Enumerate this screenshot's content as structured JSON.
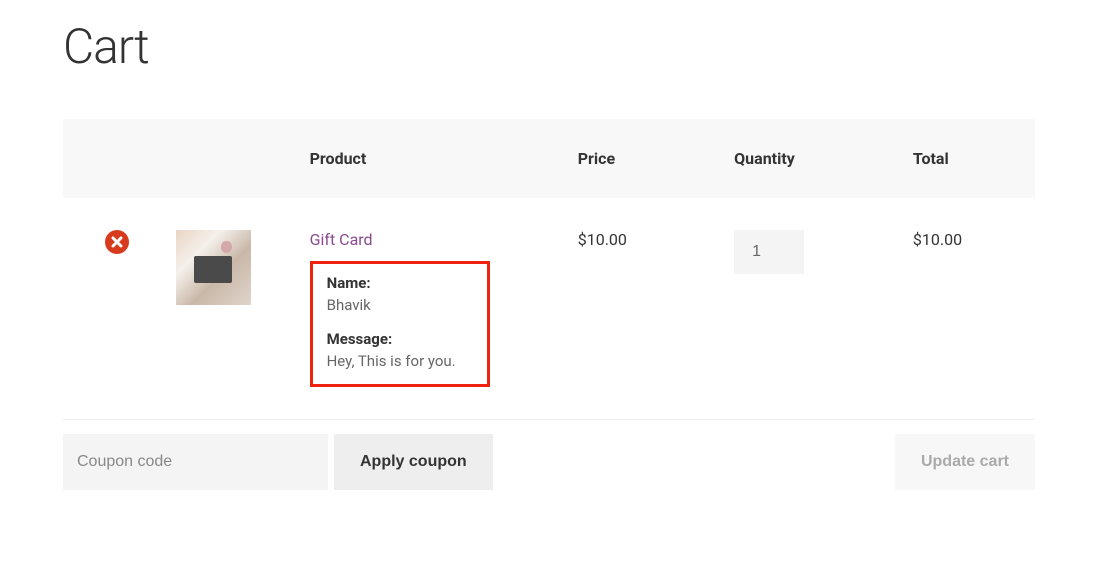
{
  "page": {
    "title": "Cart"
  },
  "table": {
    "headers": {
      "product": "Product",
      "price": "Price",
      "quantity": "Quantity",
      "total": "Total"
    }
  },
  "item": {
    "name": "Gift Card",
    "price": "$10.00",
    "quantity": "1",
    "total": "$10.00",
    "meta": {
      "name_label": "Name:",
      "name_value": "Bhavik",
      "message_label": "Message:",
      "message_value": "Hey, This is for you."
    }
  },
  "coupon": {
    "placeholder": "Coupon code",
    "apply_label": "Apply coupon"
  },
  "update_cart_label": "Update cart"
}
